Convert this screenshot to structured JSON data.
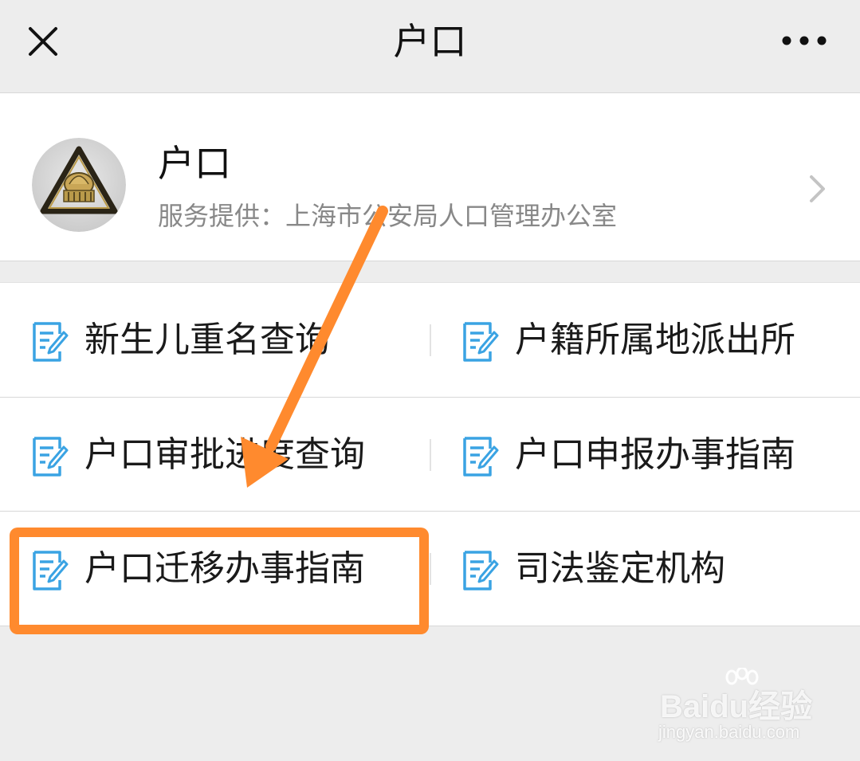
{
  "navbar": {
    "title": "户口",
    "close_icon": "close-icon",
    "more_icon": "more-dots-icon"
  },
  "service": {
    "name": "户口",
    "provider": "服务提供：上海市公安局人口管理办公室",
    "avatar_icon": "police-emblem-avatar",
    "chevron_icon": "chevron-right-icon"
  },
  "menu": {
    "items": [
      {
        "label": "新生儿重名查询",
        "icon": "document-edit-icon"
      },
      {
        "label": "户籍所属地派出所",
        "icon": "document-edit-icon"
      },
      {
        "label": "户口审批进度查询",
        "icon": "document-edit-icon"
      },
      {
        "label": "户口申报办事指南",
        "icon": "document-edit-icon"
      },
      {
        "label": "户口迁移办事指南",
        "icon": "document-edit-icon"
      },
      {
        "label": "司法鉴定机构",
        "icon": "document-edit-icon"
      }
    ]
  },
  "annotation": {
    "highlighted_item": "户口迁移办事指南",
    "color": "#ff8a2e"
  },
  "watermark": {
    "brand": "Baidu经验",
    "url": "jingyan.baidu.com"
  },
  "colors": {
    "background": "#ededed",
    "card": "#ffffff",
    "icon_blue": "#3aa3e3",
    "accent_orange": "#ff8a2e"
  }
}
